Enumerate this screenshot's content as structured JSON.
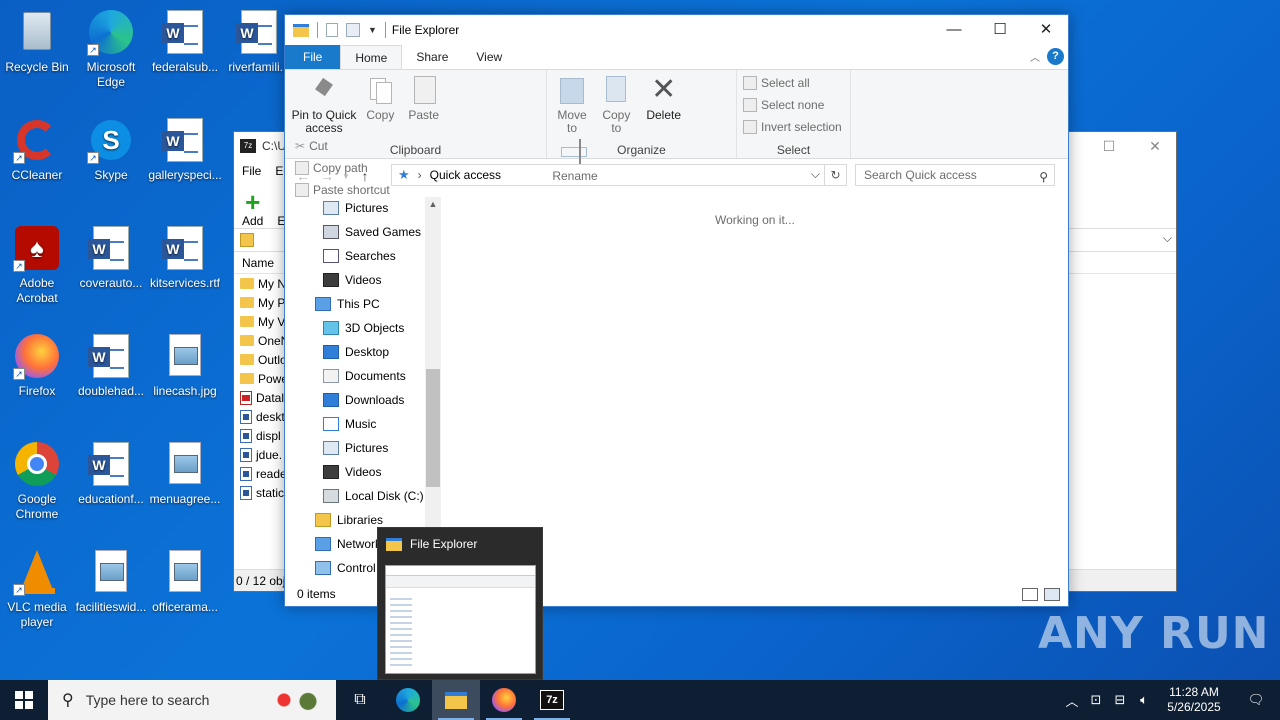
{
  "desktop": {
    "icons": [
      {
        "label": "Recycle Bin"
      },
      {
        "label": "Microsoft Edge"
      },
      {
        "label": "federalsub..."
      },
      {
        "label": "riverfamili..."
      },
      {
        "label": "CCleaner"
      },
      {
        "label": "Skype"
      },
      {
        "label": "galleryspeci..."
      },
      {
        "label": "Adobe Acrobat"
      },
      {
        "label": "coverauto..."
      },
      {
        "label": "kitservices.rtf"
      },
      {
        "label": "Firefox"
      },
      {
        "label": "doublehad..."
      },
      {
        "label": "linecash.jpg"
      },
      {
        "label": "Google Chrome"
      },
      {
        "label": "educationf..."
      },
      {
        "label": "menuagree..."
      },
      {
        "label": "VLC media player"
      },
      {
        "label": "facilitieswid..."
      },
      {
        "label": "officerama..."
      }
    ]
  },
  "sevenzip": {
    "title": "C:\\U",
    "menu": [
      "File",
      "Ed"
    ],
    "toolbar_add": "Add",
    "toolbar_e": "E",
    "column_name": "Name",
    "rows": [
      {
        "name": "My N",
        "type": "folder"
      },
      {
        "name": "My P",
        "type": "folder"
      },
      {
        "name": "My V",
        "type": "folder"
      },
      {
        "name": "OneN",
        "type": "folder"
      },
      {
        "name": "Outlo",
        "type": "folder"
      },
      {
        "name": "Powe",
        "type": "folder"
      },
      {
        "name": "Datal",
        "type": "pdf"
      },
      {
        "name": "deskt",
        "type": "doc"
      },
      {
        "name": "displ",
        "type": "doc"
      },
      {
        "name": "jdue.",
        "type": "doc"
      },
      {
        "name": "reade",
        "type": "doc"
      },
      {
        "name": "static",
        "type": "doc"
      }
    ],
    "status": "0 / 12 obj"
  },
  "explorer": {
    "title": "File Explorer",
    "tabs": {
      "file": "File",
      "home": "Home",
      "share": "Share",
      "view": "View"
    },
    "ribbon": {
      "pin": "Pin to Quick access",
      "copy": "Copy",
      "paste": "Paste",
      "cut": "Cut",
      "copy_path": "Copy path",
      "paste_shortcut": "Paste shortcut",
      "clipboard": "Clipboard",
      "move_to": "Move to",
      "copy_to": "Copy to",
      "delete": "Delete",
      "rename": "Rename",
      "organize": "Organize",
      "select_all": "Select all",
      "select_none": "Select none",
      "invert_selection": "Invert selection",
      "select": "Select"
    },
    "address": "Quick access",
    "search_placeholder": "Search Quick access",
    "nav": [
      {
        "label": "Pictures",
        "indent": 2
      },
      {
        "label": "Saved Games",
        "indent": 2
      },
      {
        "label": "Searches",
        "indent": 2
      },
      {
        "label": "Videos",
        "indent": 2
      },
      {
        "label": "This PC",
        "indent": 1
      },
      {
        "label": "3D Objects",
        "indent": 2
      },
      {
        "label": "Desktop",
        "indent": 2
      },
      {
        "label": "Documents",
        "indent": 2
      },
      {
        "label": "Downloads",
        "indent": 2
      },
      {
        "label": "Music",
        "indent": 2
      },
      {
        "label": "Pictures",
        "indent": 2
      },
      {
        "label": "Videos",
        "indent": 2
      },
      {
        "label": "Local Disk (C:)",
        "indent": 2
      },
      {
        "label": "Libraries",
        "indent": 1
      },
      {
        "label": "Network",
        "indent": 1
      },
      {
        "label": "Control Panel",
        "indent": 1
      }
    ],
    "message": "Working on it...",
    "status": "0 items"
  },
  "thumbnail": {
    "title": "File Explorer"
  },
  "taskbar": {
    "search_placeholder": "Type here to search",
    "time": "11:28 AM",
    "date": "5/26/2025"
  },
  "watermark": "ANY RUN"
}
